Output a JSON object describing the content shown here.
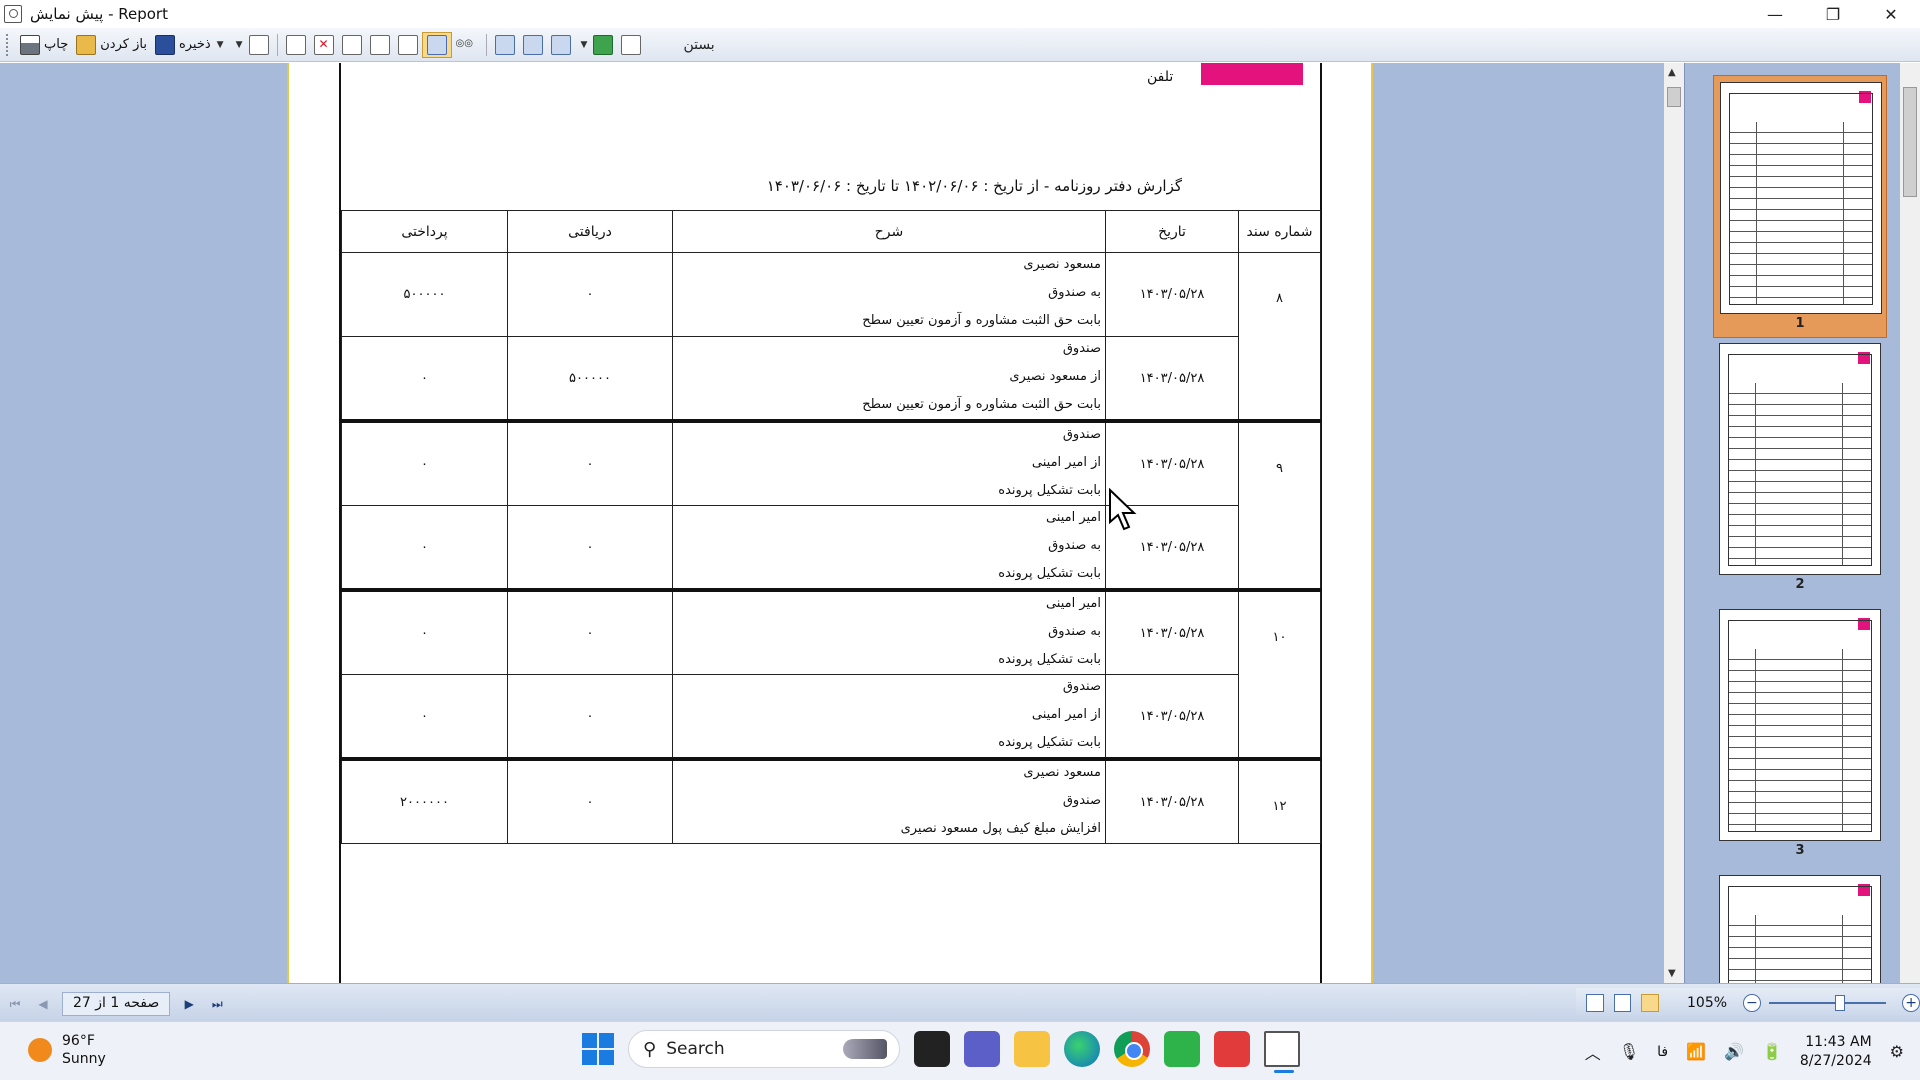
{
  "window": {
    "title": "پیش نمایش - Report",
    "controls": {
      "minimize": "—",
      "restore": "❐",
      "close": "✕"
    }
  },
  "toolbar": {
    "print_label": "چاپ",
    "open_label": "باز کردن",
    "save_label": "ذخیره",
    "close_label": "بستن"
  },
  "report": {
    "phone_label": "تلفن",
    "title": "گزارش  دفتر روزنامه - از تاریخ : ۱۴۰۲/۰۶/۰۶ تا تاریخ : ۱۴۰۳/۰۶/۰۶",
    "columns": {
      "doc_no": "شماره سند",
      "date": "تاریخ",
      "description": "شرح",
      "received": "دریافتی",
      "paid": "پرداختی"
    },
    "rows": [
      {
        "doc_no": "۸",
        "date": "۱۴۰۳/۰۵/۲۸",
        "lines": [
          "مسعود نصیری",
          "به صندوق",
          "بابت حق الثبت مشاوره و آزمون تعیین سطح"
        ],
        "received": "۰",
        "paid": "۵۰۰۰۰۰"
      },
      {
        "doc_no": "",
        "date": "۱۴۰۳/۰۵/۲۸",
        "lines": [
          "صندوق",
          "از مسعود نصیری",
          "بابت حق الثبت مشاوره و آزمون تعیین سطح"
        ],
        "received": "۵۰۰۰۰۰",
        "paid": "۰"
      },
      {
        "doc_no": "۹",
        "date": "۱۴۰۳/۰۵/۲۸",
        "lines": [
          "صندوق",
          "از امیر امینی",
          "بابت تشکیل پرونده"
        ],
        "received": "۰",
        "paid": "۰"
      },
      {
        "doc_no": "",
        "date": "۱۴۰۳/۰۵/۲۸",
        "lines": [
          "امیر امینی",
          "به صندوق",
          "بابت تشکیل پرونده"
        ],
        "received": "۰",
        "paid": "۰"
      },
      {
        "doc_no": "۱۰",
        "date": "۱۴۰۳/۰۵/۲۸",
        "lines": [
          "امیر امینی",
          "به صندوق",
          "بابت تشکیل پرونده"
        ],
        "received": "۰",
        "paid": "۰"
      },
      {
        "doc_no": "",
        "date": "۱۴۰۳/۰۵/۲۸",
        "lines": [
          "صندوق",
          "از امیر امینی",
          "بابت تشکیل پرونده"
        ],
        "received": "۰",
        "paid": "۰"
      },
      {
        "doc_no": "۱۲",
        "date": "۱۴۰۳/۰۵/۲۸",
        "lines": [
          "مسعود نصیری",
          "صندوق",
          "افزایش مبلغ کیف پول مسعود نصیری"
        ],
        "received": "۰",
        "paid": "۲۰۰۰۰۰۰"
      }
    ]
  },
  "thumbnails": [
    {
      "label": "1",
      "selected": true
    },
    {
      "label": "2",
      "selected": false
    },
    {
      "label": "3",
      "selected": false
    }
  ],
  "status": {
    "page_text": "صفحه 1 از 27",
    "zoom": "105%",
    "zoom_out": "−",
    "zoom_in": "+"
  },
  "taskbar": {
    "weather_temp": "96°F",
    "weather_desc": "Sunny",
    "search_label": "Search",
    "lang": "فا",
    "time": "11:43 AM",
    "date": "8/27/2024"
  },
  "colors": {
    "accent_pink": "#e3127d",
    "preview_bg": "#a7bad9",
    "thumb_selected": "#e59a5a"
  }
}
